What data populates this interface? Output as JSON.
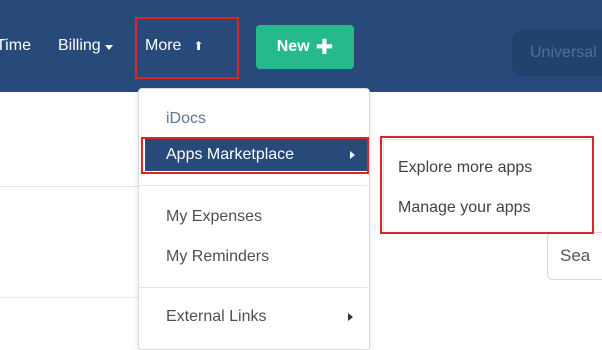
{
  "nav": {
    "items": [
      {
        "label": "Time"
      },
      {
        "label": "Billing"
      },
      {
        "label": "More"
      }
    ],
    "new_button_label": "New",
    "new_button_icon": "plus-icon",
    "search_placeholder": "Universal",
    "brand_color": "#274a7a",
    "accent_color": "#27b98e",
    "highlight_color": "#e02424"
  },
  "dropdown": {
    "items": [
      {
        "label": "iDocs"
      },
      {
        "label": "Apps Marketplace"
      },
      {
        "label": "My Expenses"
      },
      {
        "label": "My Reminders"
      },
      {
        "label": "External Links"
      }
    ]
  },
  "submenu": {
    "items": [
      {
        "label": "Explore more apps"
      },
      {
        "label": "Manage your apps"
      }
    ]
  },
  "page": {
    "search_placeholder": "Sea"
  }
}
